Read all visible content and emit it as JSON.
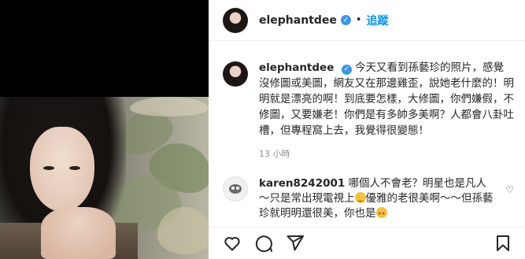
{
  "post": {
    "username": "elephantdee",
    "follow_label": "追蹤",
    "separator": "•"
  },
  "caption": {
    "username": "elephantdee",
    "text": "今天又看到孫藝珍的照片，感覺沒修圖或美圖，網友又在那邊雞歪，說她老什麼的！明明就是漂亮的啊！到底要怎樣，大修圖，你們嫌假，不修圖，又要嫌老！你們是有多帥多美啊？人都會八卦吐槽，但專程窩上去，我覺得很變態！",
    "time": "13 小時"
  },
  "comment": {
    "username": "karen8242001",
    "text_part1": "哪個人不會老？明星也是凡人～只是常出現電視上",
    "text_part2": "優雅的老很美啊～～但孫藝珍就明明還很美，你也是",
    "emoji1": "smiling-face-emoji",
    "emoji2": "star-struck-emoji"
  },
  "icons": {
    "like": "heart-icon",
    "comment": "comment-icon",
    "share": "share-icon",
    "save": "bookmark-icon",
    "verified": "verified-badge-icon"
  },
  "colors": {
    "accent": "#0095f6",
    "verified": "#3897f0",
    "secondary_text": "#8e8e8e"
  }
}
